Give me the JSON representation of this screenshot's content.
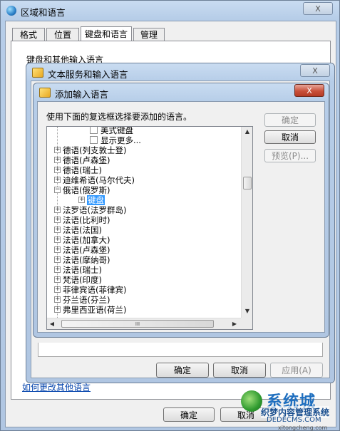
{
  "region_window": {
    "title": "区域和语言",
    "tabs": [
      "格式",
      "位置",
      "键盘和语言",
      "管理"
    ],
    "section_label": "键盘和其他输入语言",
    "ok": "确定",
    "cancel": "取消",
    "link": "如何更改其他语言"
  },
  "text_services_window": {
    "title": "文本服务和输入语言",
    "ok": "确定",
    "cancel": "取消",
    "apply": "应用(A)"
  },
  "add_dialog": {
    "title": "添加输入语言",
    "instruction": "使用下面的复选框选择要添加的语言。",
    "ok": "确定",
    "cancel": "取消",
    "preview": "预览(P)...",
    "tree": [
      {
        "type": "check",
        "label": "美式键盘"
      },
      {
        "type": "check",
        "label": "显示更多..."
      },
      {
        "type": "node",
        "label": "德语(列支敦士登)",
        "expander": "+"
      },
      {
        "type": "node",
        "label": "德语(卢森堡)",
        "expander": "+"
      },
      {
        "type": "node",
        "label": "德语(瑞士)",
        "expander": "+"
      },
      {
        "type": "node",
        "label": "迪维希语(马尔代夫)",
        "expander": "+"
      },
      {
        "type": "node",
        "label": "俄语(俄罗斯)",
        "expander": "−"
      },
      {
        "type": "child",
        "label": "键盘",
        "expander": "+",
        "selected": true
      },
      {
        "type": "node",
        "label": "法罗语(法罗群岛)",
        "expander": "+"
      },
      {
        "type": "node",
        "label": "法语(比利时)",
        "expander": "+"
      },
      {
        "type": "node",
        "label": "法语(法国)",
        "expander": "+"
      },
      {
        "type": "node",
        "label": "法语(加拿大)",
        "expander": "+"
      },
      {
        "type": "node",
        "label": "法语(卢森堡)",
        "expander": "+"
      },
      {
        "type": "node",
        "label": "法语(摩纳哥)",
        "expander": "+"
      },
      {
        "type": "node",
        "label": "法语(瑞士)",
        "expander": "+"
      },
      {
        "type": "node",
        "label": "梵语(印度)",
        "expander": "+"
      },
      {
        "type": "node",
        "label": "菲律宾语(菲律宾)",
        "expander": "+"
      },
      {
        "type": "node",
        "label": "芬兰语(芬兰)",
        "expander": "+"
      },
      {
        "type": "node",
        "label": "弗里西亚语(荷兰)",
        "expander": "+"
      }
    ],
    "hscroll_grip": "III"
  },
  "close_label": "X",
  "watermark": {
    "brand": "系统城",
    "line": "织梦内容管理系统",
    "url": "xitongcheng.com",
    "url2": "DEDECMS.COM"
  }
}
